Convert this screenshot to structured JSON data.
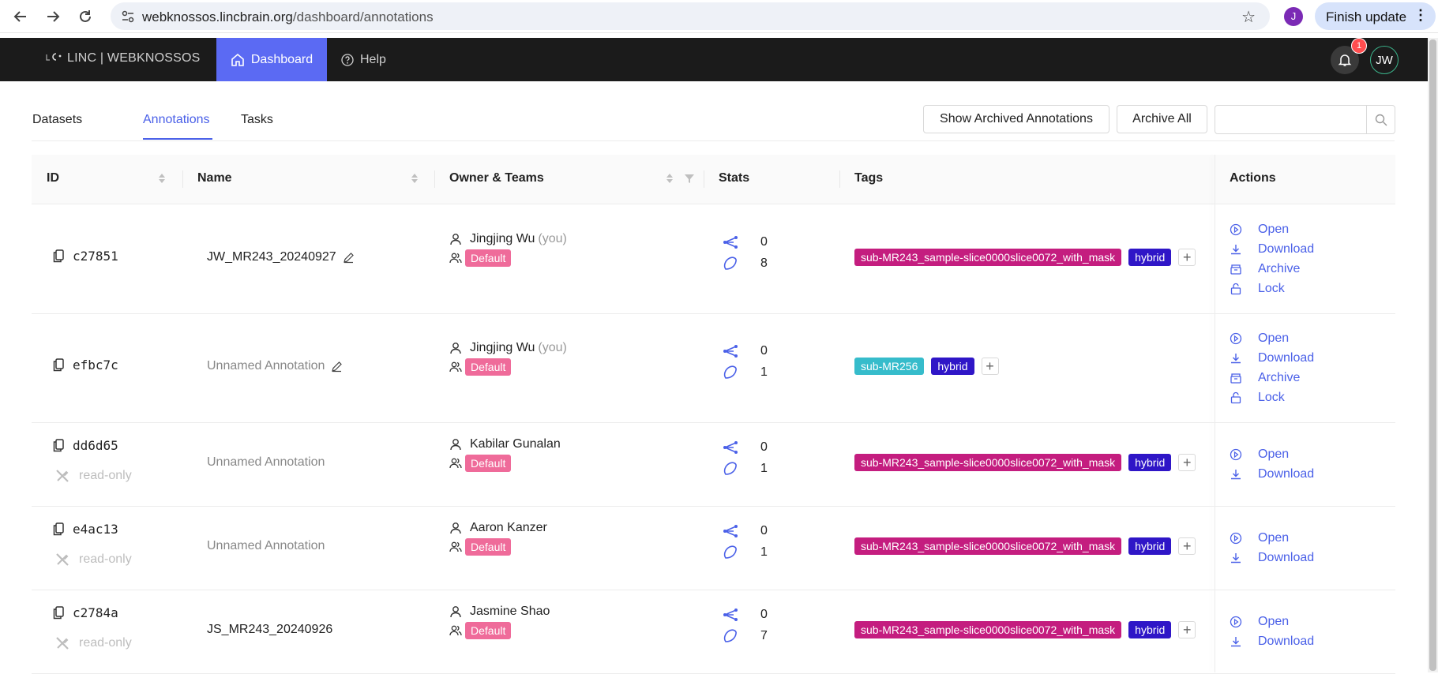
{
  "browser": {
    "url_host": "webknossos.lincbrain.org",
    "url_path": "/dashboard/annotations",
    "profile_initial": "J",
    "update_button": "Finish update"
  },
  "app": {
    "brand": "LINC | WEBKNOSSOS",
    "nav": [
      {
        "label": "Dashboard",
        "icon": "home-icon",
        "active": true
      },
      {
        "label": "Help",
        "icon": "question-circle-icon",
        "active": false
      }
    ],
    "notification_count": "1",
    "user_initials": "JW"
  },
  "tabs": {
    "items": [
      "Datasets",
      "Annotations",
      "Tasks"
    ],
    "active": "Annotations"
  },
  "toolbar": {
    "show_archived": "Show Archived Annotations",
    "archive_all": "Archive All",
    "search_placeholder": ""
  },
  "table": {
    "columns": [
      "ID",
      "Name",
      "Owner & Teams",
      "Stats",
      "Tags",
      "Actions"
    ],
    "rows": [
      {
        "id": "c27851",
        "readonly": false,
        "readonly_label": "",
        "name": "JW_MR243_20240927",
        "name_muted": false,
        "editable": true,
        "owner": "Jingjing Wu",
        "owner_suffix": "(you)",
        "team": "Default",
        "stat_trees": "0",
        "stat_segments": "8",
        "tags": [
          {
            "label": "sub-MR243_sample-slice0000slice0072_with_mask",
            "color": "#c41d7f"
          },
          {
            "label": "hybrid",
            "color": "#2f16c7"
          }
        ],
        "actions": [
          "Open",
          "Download",
          "Archive",
          "Lock"
        ]
      },
      {
        "id": "efbc7c",
        "readonly": false,
        "readonly_label": "",
        "name": "Unnamed Annotation",
        "name_muted": true,
        "editable": true,
        "owner": "Jingjing Wu",
        "owner_suffix": "(you)",
        "team": "Default",
        "stat_trees": "0",
        "stat_segments": "1",
        "tags": [
          {
            "label": "sub-MR256",
            "color": "#36bccb"
          },
          {
            "label": "hybrid",
            "color": "#2f16c7"
          }
        ],
        "actions": [
          "Open",
          "Download",
          "Archive",
          "Lock"
        ]
      },
      {
        "id": "dd6d65",
        "readonly": true,
        "readonly_label": "read-only",
        "name": "Unnamed Annotation",
        "name_muted": true,
        "editable": false,
        "owner": "Kabilar Gunalan",
        "owner_suffix": "",
        "team": "Default",
        "stat_trees": "0",
        "stat_segments": "1",
        "tags": [
          {
            "label": "sub-MR243_sample-slice0000slice0072_with_mask",
            "color": "#c41d7f"
          },
          {
            "label": "hybrid",
            "color": "#2f16c7"
          }
        ],
        "actions": [
          "Open",
          "Download"
        ]
      },
      {
        "id": "e4ac13",
        "readonly": true,
        "readonly_label": "read-only",
        "name": "Unnamed Annotation",
        "name_muted": true,
        "editable": false,
        "owner": "Aaron Kanzer",
        "owner_suffix": "",
        "team": "Default",
        "stat_trees": "0",
        "stat_segments": "1",
        "tags": [
          {
            "label": "sub-MR243_sample-slice0000slice0072_with_mask",
            "color": "#c41d7f"
          },
          {
            "label": "hybrid",
            "color": "#2f16c7"
          }
        ],
        "actions": [
          "Open",
          "Download"
        ]
      },
      {
        "id": "c2784a",
        "readonly": true,
        "readonly_label": "read-only",
        "name": "JS_MR243_20240926",
        "name_muted": false,
        "editable": false,
        "owner": "Jasmine Shao",
        "owner_suffix": "",
        "team": "Default",
        "stat_trees": "0",
        "stat_segments": "7",
        "tags": [
          {
            "label": "sub-MR243_sample-slice0000slice0072_with_mask",
            "color": "#c41d7f"
          },
          {
            "label": "hybrid",
            "color": "#2f16c7"
          }
        ],
        "actions": [
          "Open",
          "Download"
        ]
      }
    ]
  },
  "colors": {
    "accent": "#4a60e8",
    "header_bg": "#1b1b1b",
    "active_nav": "#5b6af3",
    "team_tag": "#ef6b9a"
  }
}
